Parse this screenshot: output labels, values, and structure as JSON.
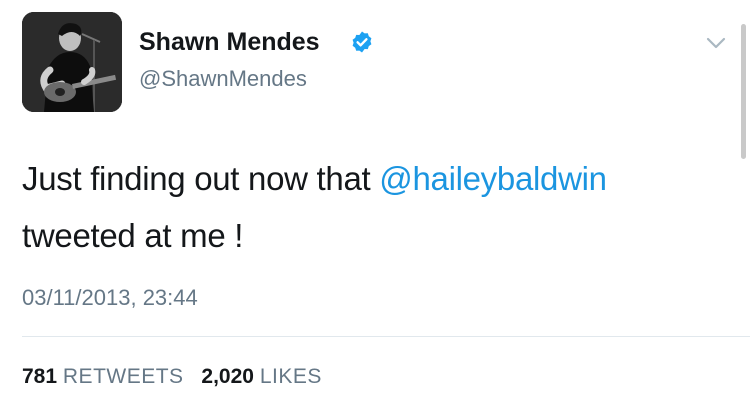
{
  "user": {
    "display_name": "Shawn Mendes",
    "handle": "@ShawnMendes",
    "verified": true,
    "avatar_icon": "profile-photo-guitar"
  },
  "tweet": {
    "text_before": "Just finding out now that ",
    "mention": "@haileybaldwin",
    "text_after": " tweeted at me !",
    "timestamp": "03/11/2013, 23:44"
  },
  "stats": {
    "retweets_count": "781",
    "retweets_label": "RETWEETS",
    "likes_count": "2,020",
    "likes_label": "LIKES"
  },
  "colors": {
    "link": "#1b95e0",
    "verified": "#1da1f2",
    "secondary_text": "#657786",
    "primary_text": "#14171a"
  },
  "icons": {
    "verified": "verified-badge-icon",
    "menu": "chevron-down-icon"
  }
}
